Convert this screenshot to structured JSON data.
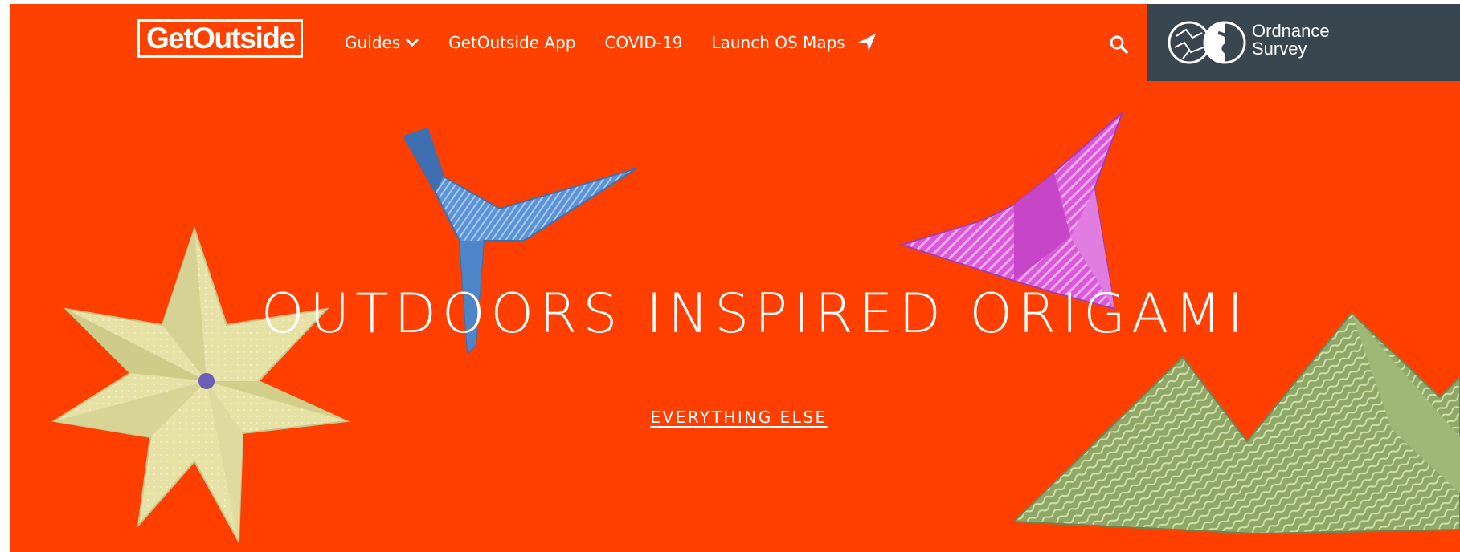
{
  "header": {
    "logo_text": "GetOutside",
    "nav": [
      {
        "label": "Guides",
        "icon": "chevron-down-icon"
      },
      {
        "label": "GetOutside App"
      },
      {
        "label": "COVID-19"
      },
      {
        "label": "Launch OS Maps",
        "icon": "navigation-arrow-icon"
      }
    ],
    "search_icon": "search-icon",
    "partner": {
      "line1": "Ordnance",
      "line2": "Survey"
    }
  },
  "hero": {
    "title": "OUTDOORS INSPIRED ORIGAMI",
    "link_label": "EVERYTHING ELSE"
  },
  "colors": {
    "brand_orange": "#ff4100",
    "os_panel": "#39464f",
    "text": "#ffffff"
  }
}
